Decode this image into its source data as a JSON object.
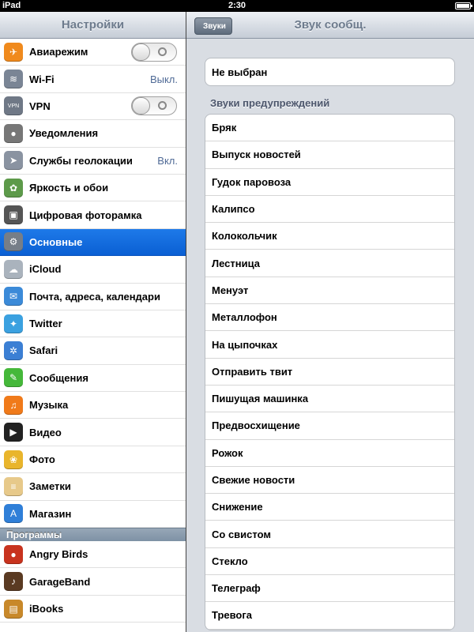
{
  "status_bar": {
    "device": "iPad",
    "time": "2:30"
  },
  "left": {
    "title": "Настройки",
    "items": [
      {
        "label": "Авиарежим",
        "icon": "airplane-icon",
        "color": "#f08a1d",
        "glyph": "✈",
        "toggle": true
      },
      {
        "label": "Wi-Fi",
        "icon": "wifi-icon",
        "color": "#7a8595",
        "glyph": "≋",
        "value": "Выкл."
      },
      {
        "label": "VPN",
        "icon": "vpn-icon",
        "color": "#6f7886",
        "glyph": "VPN",
        "toggle": true
      },
      {
        "label": "Уведомления",
        "icon": "notifications-icon",
        "color": "#777",
        "glyph": "●"
      },
      {
        "label": "Службы геолокации",
        "icon": "location-icon",
        "color": "#8a93a1",
        "glyph": "➤",
        "value": "Вкл."
      },
      {
        "label": "Яркость и обои",
        "icon": "brightness-icon",
        "color": "#5d9a4a",
        "glyph": "✿"
      },
      {
        "label": "Цифровая фоторамка",
        "icon": "photo-frame-icon",
        "color": "#555",
        "glyph": "▣"
      },
      {
        "label": "Основные",
        "icon": "gear-icon",
        "color": "#767e88",
        "glyph": "⚙",
        "selected": true
      },
      {
        "label": "iCloud",
        "icon": "cloud-icon",
        "color": "#aab3bd",
        "glyph": "☁"
      },
      {
        "label": "Почта, адреса, календари",
        "icon": "mail-icon",
        "color": "#3b8ad8",
        "glyph": "✉"
      },
      {
        "label": "Twitter",
        "icon": "twitter-icon",
        "color": "#3ba1e0",
        "glyph": "✦"
      },
      {
        "label": "Safari",
        "icon": "safari-icon",
        "color": "#3b7fd4",
        "glyph": "✲"
      },
      {
        "label": "Сообщения",
        "icon": "messages-icon",
        "color": "#45b83a",
        "glyph": "✎"
      },
      {
        "label": "Музыка",
        "icon": "music-icon",
        "color": "#f07a1a",
        "glyph": "♫"
      },
      {
        "label": "Видео",
        "icon": "video-icon",
        "color": "#222",
        "glyph": "▶"
      },
      {
        "label": "Фото",
        "icon": "photos-icon",
        "color": "#e9b52c",
        "glyph": "❀"
      },
      {
        "label": "Заметки",
        "icon": "notes-icon",
        "color": "#e7c98a",
        "glyph": "≡"
      },
      {
        "label": "Магазин",
        "icon": "store-icon",
        "color": "#2f7fd8",
        "glyph": "A"
      }
    ],
    "apps_section": "Программы",
    "apps": [
      {
        "label": "Angry Birds",
        "icon": "angry-birds-icon",
        "color": "#c8331e",
        "glyph": "●"
      },
      {
        "label": "GarageBand",
        "icon": "garageband-icon",
        "color": "#5a3a22",
        "glyph": "♪"
      },
      {
        "label": "iBooks",
        "icon": "ibooks-icon",
        "color": "#c8882a",
        "glyph": "▤"
      }
    ]
  },
  "right": {
    "title": "Звук сообщ.",
    "back_label": "Звуки",
    "none_option": "Не выбран",
    "alerts_label": "Звуки предупреждений",
    "alerts": [
      "Бряк",
      "Выпуск новостей",
      "Гудок паровоза",
      "Калипсо",
      "Колокольчик",
      "Лестница",
      "Менуэт",
      "Металлофон",
      "На цыпочках",
      "Отправить твит",
      "Пишущая машинка",
      "Предвосхищение",
      "Рожок",
      "Свежие новости",
      "Снижение",
      "Со свистом",
      "Стекло",
      "Телеграф",
      "Тревога"
    ]
  }
}
